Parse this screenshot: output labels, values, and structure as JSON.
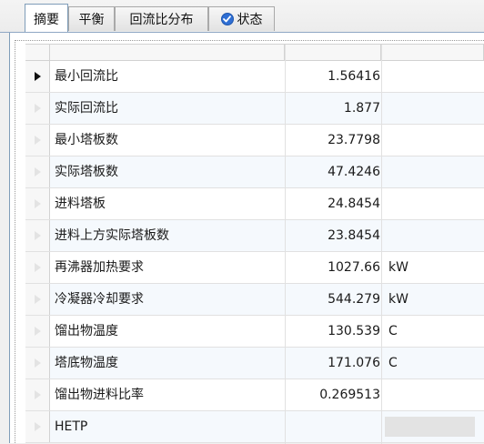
{
  "tabs": [
    {
      "label": "摘要",
      "active": true
    },
    {
      "label": "平衡",
      "active": false
    },
    {
      "label": "回流比分布",
      "active": false
    },
    {
      "label": "状态",
      "active": false,
      "icon": "check-circle-icon"
    }
  ],
  "grid": {
    "columns": [
      "",
      "",
      ""
    ],
    "selected_row": 0,
    "rows": [
      {
        "name": "最小回流比",
        "value": "1.56416",
        "unit": ""
      },
      {
        "name": "实际回流比",
        "value": "1.877",
        "unit": ""
      },
      {
        "name": "最小塔板数",
        "value": "23.7798",
        "unit": ""
      },
      {
        "name": "实际塔板数",
        "value": "47.4246",
        "unit": ""
      },
      {
        "name": "进料塔板",
        "value": "24.8454",
        "unit": ""
      },
      {
        "name": "进料上方实际塔板数",
        "value": "23.8454",
        "unit": ""
      },
      {
        "name": "再沸器加热要求",
        "value": "1027.66",
        "unit": "kW"
      },
      {
        "name": "冷凝器冷却要求",
        "value": "544.279",
        "unit": "kW"
      },
      {
        "name": "馏出物温度",
        "value": "130.539",
        "unit": "C"
      },
      {
        "name": "塔底物温度",
        "value": "171.076",
        "unit": "C"
      },
      {
        "name": "馏出物进料比率",
        "value": "0.269513",
        "unit": ""
      },
      {
        "name": "HETP",
        "value": "",
        "unit": ""
      }
    ]
  },
  "colors": {
    "tab_border": "#7f9db9",
    "alt_row": "#f5f9fd",
    "check_icon": "#2f6fd4"
  }
}
